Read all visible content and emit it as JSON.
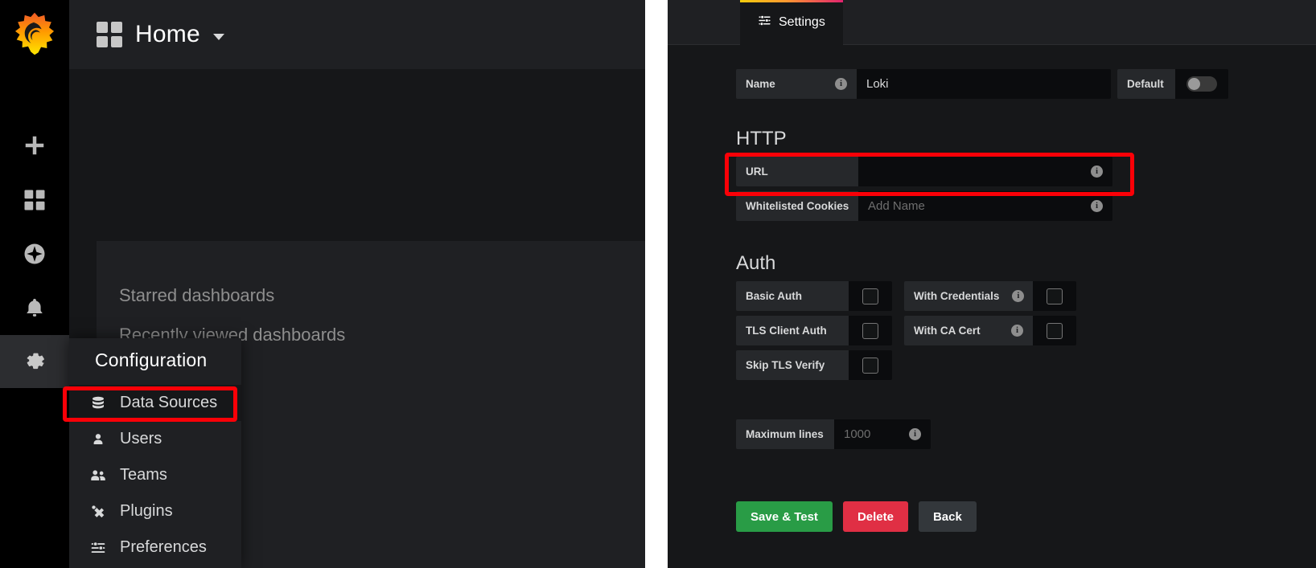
{
  "left_panel": {
    "brand_icon": "grafana-logo-icon",
    "topbar": {
      "grid_icon": "dashboard-grid-icon",
      "title": "Home",
      "caret_icon": "chevron-down-icon"
    },
    "sidebar_icons": [
      {
        "name": "plus-icon",
        "label": "Create"
      },
      {
        "name": "dashboards-grid-icon",
        "label": "Dashboards"
      },
      {
        "name": "compass-icon",
        "label": "Explore"
      },
      {
        "name": "bell-icon",
        "label": "Alerting"
      },
      {
        "name": "gear-icon",
        "label": "Configuration"
      }
    ],
    "card": {
      "starred": "Starred dashboards",
      "recent": "Recently viewed dashboards"
    },
    "config_menu": {
      "title": "Configuration",
      "items": [
        {
          "label": "Data Sources",
          "icon": "database-icon"
        },
        {
          "label": "Users",
          "icon": "user-icon"
        },
        {
          "label": "Teams",
          "icon": "users-group-icon"
        },
        {
          "label": "Plugins",
          "icon": "plugin-icon"
        },
        {
          "label": "Preferences",
          "icon": "sliders-icon"
        }
      ]
    }
  },
  "right_panel": {
    "tab": {
      "label": "Settings",
      "icon": "sliders-icon"
    },
    "name_row": {
      "label": "Name",
      "info_icon": "info-icon",
      "value": "Loki",
      "default_label": "Default",
      "default_on": false
    },
    "http": {
      "title": "HTTP",
      "url": {
        "label": "URL",
        "value": "",
        "info_icon": "info-icon"
      },
      "whitelisted_cookies": {
        "label": "Whitelisted Cookies",
        "placeholder": "Add Name",
        "info_icon": "info-icon"
      }
    },
    "auth": {
      "title": "Auth",
      "left_rows": [
        {
          "label": "Basic Auth",
          "checked": false
        },
        {
          "label": "TLS Client Auth",
          "checked": false
        },
        {
          "label": "Skip TLS Verify",
          "checked": false
        }
      ],
      "right_rows": [
        {
          "label": "With Credentials",
          "checked": false,
          "info_icon": "info-icon"
        },
        {
          "label": "With CA Cert",
          "checked": false,
          "info_icon": "info-icon"
        }
      ]
    },
    "max_lines": {
      "label": "Maximum lines",
      "placeholder": "1000",
      "info_icon": "info-icon"
    },
    "buttons": {
      "save": "Save & Test",
      "delete": "Delete",
      "back": "Back"
    }
  },
  "annotations": {
    "highlight_color": "#fb0007",
    "boxes": [
      {
        "name": "data-sources-highlight"
      },
      {
        "name": "url-field-highlight"
      }
    ]
  }
}
